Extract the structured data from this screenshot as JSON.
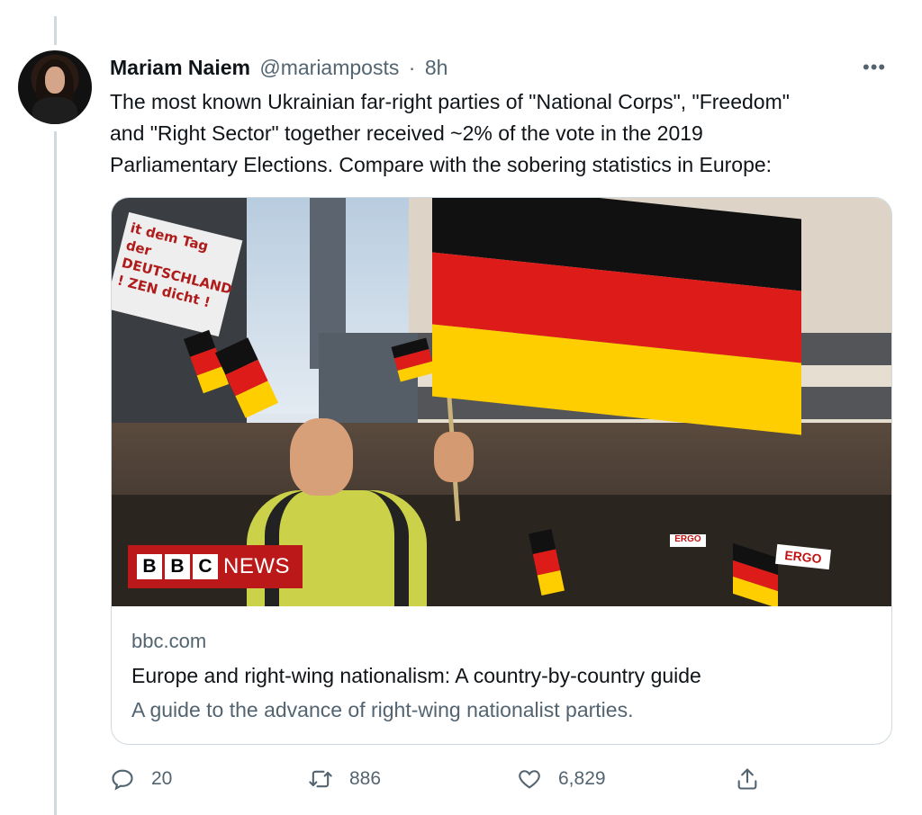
{
  "tweet": {
    "author_name": "Mariam Naiem",
    "handle": "@mariamposts",
    "separator": "·",
    "time": "8h",
    "more_label": "•••",
    "text_lines": [
      "The most known Ukrainian far-right parties of \"National Corps\", \"Freedom\"",
      "and \"Right Sector\" together received ~2% of the vote in the 2019",
      "Parliamentary Elections. Compare with the sobering statistics in Europe:"
    ]
  },
  "card": {
    "image_banner_text": "it dem Tag der DEUTSCHLAND ! ZEN dicht !",
    "bbc_letters": [
      "B",
      "B",
      "C"
    ],
    "bbc_news": "NEWS",
    "ergo_sign_1": "ERGO",
    "ergo_sign_2": "ERGO",
    "domain": "bbc.com",
    "title": "Europe and right-wing nationalism: A country-by-country guide",
    "description": "A guide to the advance of right-wing nationalist parties."
  },
  "actions": {
    "reply_count": "20",
    "retweet_count": "886",
    "like_count": "6,829",
    "icons": [
      "reply-icon",
      "retweet-icon",
      "like-icon",
      "share-icon"
    ]
  },
  "colors": {
    "secondary_text": "#536471",
    "border": "#cfd9de",
    "bbc_red": "#bb1919"
  }
}
